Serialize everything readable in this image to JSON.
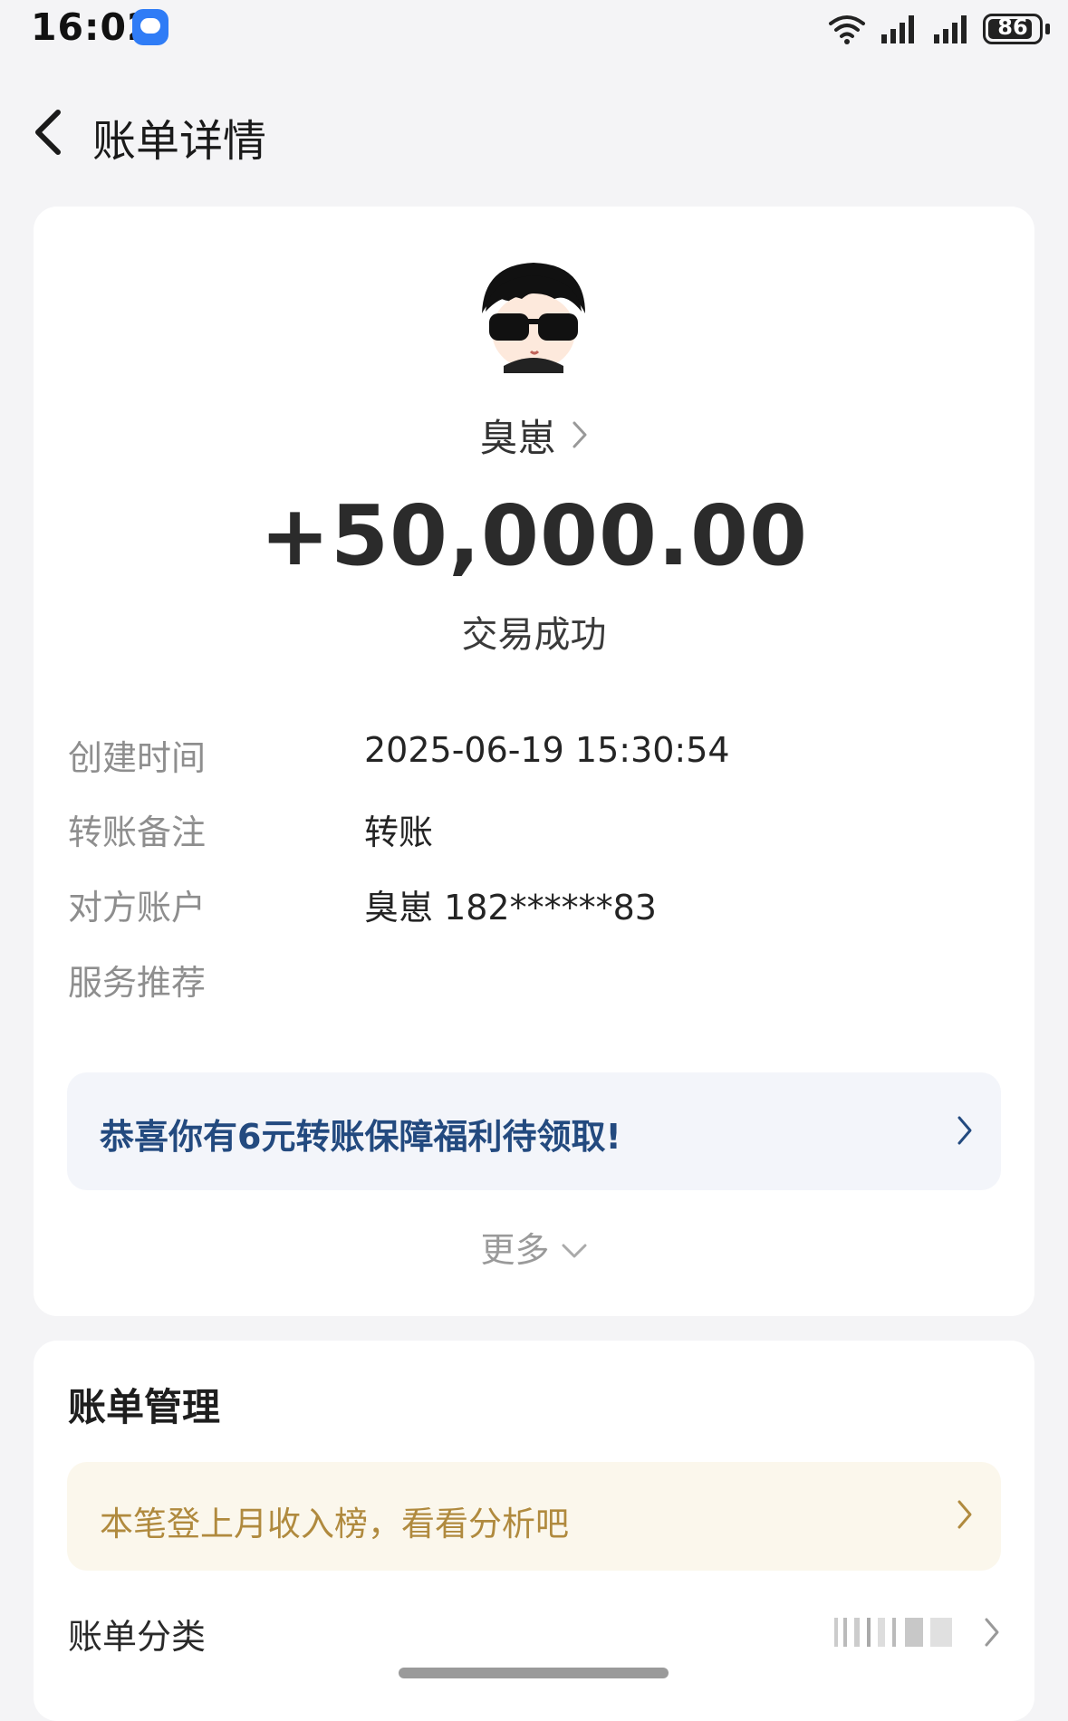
{
  "status_bar": {
    "time": "16:02",
    "battery": "86",
    "icons": [
      "message-icon",
      "wifi-icon",
      "signal-icon",
      "signal-icon",
      "battery-icon"
    ]
  },
  "header": {
    "title": "账单详情",
    "back_icon": "chevron-left-icon"
  },
  "transaction": {
    "payee": "臭崽",
    "amount": "+50,000.00",
    "status": "交易成功",
    "details": [
      {
        "label": "创建时间",
        "value": "2025-06-19 15:30:54"
      },
      {
        "label": "转账备注",
        "value": "转账"
      },
      {
        "label": "对方账户",
        "value": "臭崽 182******83"
      }
    ],
    "service_label": "服务推荐",
    "promo": "恭喜你有6元转账保障福利待领取!",
    "more": "更多"
  },
  "management": {
    "title": "账单管理",
    "banner": "本笔登上月收入榜，看看分析吧",
    "category_label": "账单分类"
  },
  "colors": {
    "page_bg": "#f4f4f6",
    "card_bg": "#ffffff",
    "promo_bg": "#f3f5fa",
    "promo_text": "#234a7f",
    "banner_bg": "#fbf7ec",
    "banner_text": "#b08a3e"
  }
}
